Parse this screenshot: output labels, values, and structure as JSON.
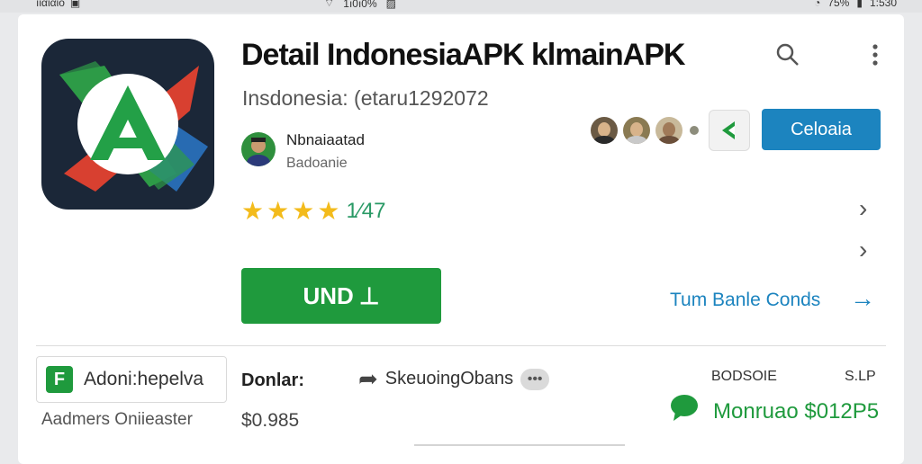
{
  "status_bar": {
    "time": "1:530",
    "battery": "7̃5%",
    "signal_text": "1ı0ı0%",
    "left_text": "ıιαιαιο"
  },
  "app": {
    "title": "Detail IndonesiaAPK klmainAPK",
    "subtitle": "Insdonesia: (etaru1292072",
    "developer_name": "Nbnaiaatad",
    "developer_sub": "Badoanie",
    "rating_text": "1⁄47",
    "star_count": 4,
    "primary_button": "Celoaia",
    "install_button": "UND",
    "link_text": "Tum Banle Conds"
  },
  "details": {
    "chip_icon_letter": "F",
    "chip_label": "Adoni:hepelva",
    "developer_label": "Donlar:",
    "share_label": "SkeuoingObans",
    "col_head_1": "BODSOIE",
    "col_head_2": "S.LP",
    "green_line": "Monruao $012P5",
    "footer_left": "Aadmers Oniieaster",
    "price": "$0.985"
  },
  "colors": {
    "accent_blue": "#1c84bf",
    "install_green": "#1f9a3d",
    "star_yellow": "#f3bb1b",
    "rating_green": "#2a9a66"
  },
  "icons": {
    "search": "search-icon",
    "more": "more-vert-icon",
    "play": "play-icon",
    "share": "share-icon",
    "chat": "chat-icon"
  }
}
